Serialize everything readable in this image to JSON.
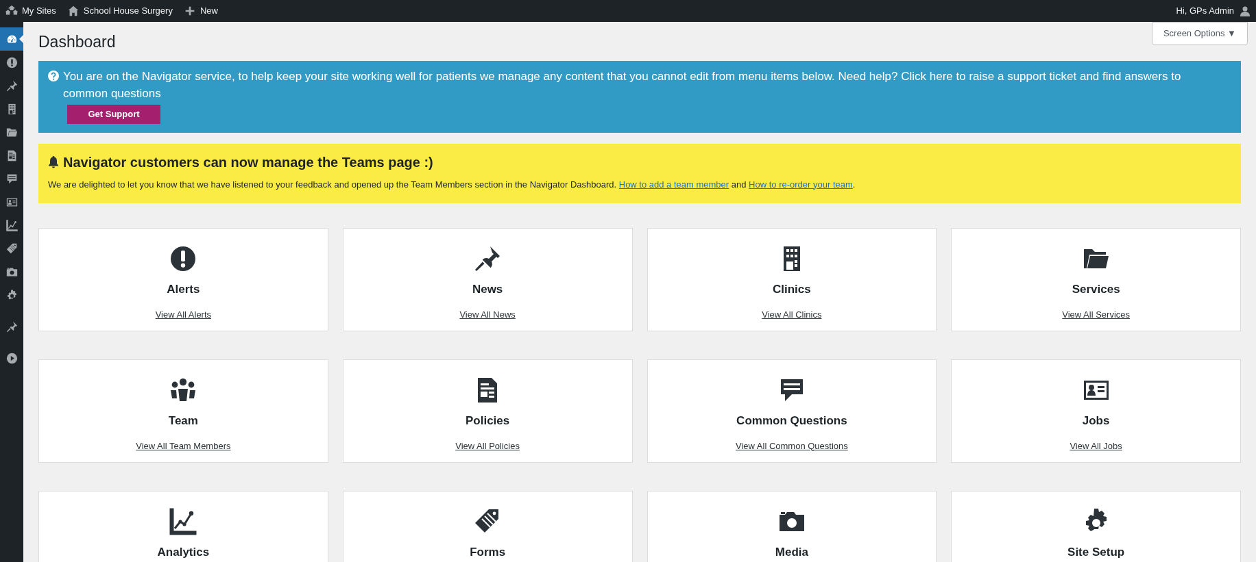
{
  "admin_bar": {
    "items": [
      {
        "kind": "sites",
        "label": "My Sites"
      },
      {
        "kind": "home",
        "label": "School House Surgery"
      },
      {
        "kind": "plus",
        "label": "New"
      }
    ],
    "greeting": "Hi, GPs Admin"
  },
  "sidebar": {
    "items": [
      {
        "kind": "dashboard",
        "selected": true
      },
      {
        "kind": "alert",
        "selected": false
      },
      {
        "kind": "pin",
        "selected": false
      },
      {
        "kind": "building",
        "selected": false
      },
      {
        "kind": "folder",
        "selected": false
      },
      {
        "kind": "document",
        "selected": false
      },
      {
        "kind": "chat",
        "selected": false
      },
      {
        "kind": "idcard",
        "selected": false
      },
      {
        "kind": "chart",
        "selected": false
      },
      {
        "kind": "tag",
        "selected": false
      },
      {
        "kind": "camera",
        "selected": false
      },
      {
        "kind": "gear",
        "selected": false
      },
      {
        "kind": "pin",
        "selected": false
      },
      {
        "kind": "play",
        "selected": false
      }
    ]
  },
  "screen_options": "Screen Options ▼",
  "page_title": "Dashboard",
  "support_notice": {
    "text": "You are on the Navigator service, to help keep your site working well for patients we manage any content that you cannot edit from menu items below. Need help? Click here to raise a support ticket and find answers to common questions",
    "button": "Get Support"
  },
  "teams_notice": {
    "title": "Navigator customers can now manage the Teams page :)",
    "text": "We are delighted to let you know that we have listened to your feedback and opened up the Team Members section in the Navigator Dashboard.",
    "link_1": "How to add a team member",
    "joiner": "and",
    "link_2": "How to re-order your team",
    "end": "."
  },
  "cards": [
    {
      "kind": "alert",
      "title": "Alerts",
      "link": "View All Alerts"
    },
    {
      "kind": "pin",
      "title": "News",
      "link": "View All News"
    },
    {
      "kind": "building",
      "title": "Clinics",
      "link": "View All Clinics"
    },
    {
      "kind": "folder",
      "title": "Services",
      "link": "View All Services"
    },
    {
      "kind": "team",
      "title": "Team",
      "link": "View All Team Members"
    },
    {
      "kind": "document",
      "title": "Policies",
      "link": "View All Policies"
    },
    {
      "kind": "chat",
      "title": "Common Questions",
      "link": "View All Common Questions"
    },
    {
      "kind": "idcard",
      "title": "Jobs",
      "link": "View All Jobs"
    },
    {
      "kind": "chart",
      "title": "Analytics"
    },
    {
      "kind": "tag",
      "title": "Forms"
    },
    {
      "kind": "camera",
      "title": "Media"
    },
    {
      "kind": "gear",
      "title": "Site Setup"
    }
  ]
}
